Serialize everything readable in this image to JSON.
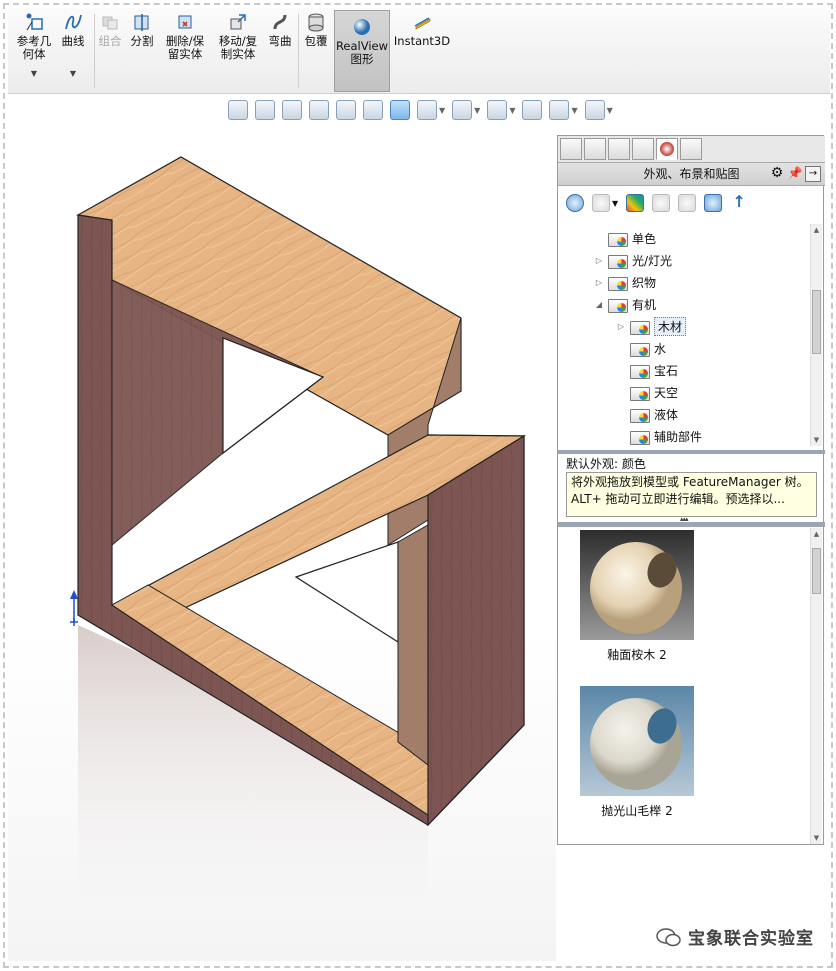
{
  "ribbon": {
    "buttons": [
      {
        "id": "ref-geometry",
        "label": "参考几\n何体",
        "has_caret": true
      },
      {
        "id": "curves",
        "label": "曲线",
        "has_caret": true
      },
      {
        "id": "combine",
        "label": "组合",
        "disabled": true
      },
      {
        "id": "split",
        "label": "分割"
      },
      {
        "id": "delete-keep-body",
        "label": "删除/保\n留实体"
      },
      {
        "id": "move-copy-body",
        "label": "移动/复\n制实体"
      },
      {
        "id": "flex",
        "label": "弯曲"
      },
      {
        "id": "wrap",
        "label": "包覆"
      },
      {
        "id": "realview",
        "label": "RealView\n图形",
        "active": true
      },
      {
        "id": "instant3d",
        "label": "Instant3D"
      }
    ]
  },
  "taskpane": {
    "title": "外观、布景和贴图",
    "tree": [
      {
        "label": "单色",
        "level": 1,
        "expand": ""
      },
      {
        "label": "光/灯光",
        "level": 1,
        "expand": "▷"
      },
      {
        "label": "织物",
        "level": 1,
        "expand": "▷"
      },
      {
        "label": "有机",
        "level": 1,
        "expand": "◢"
      },
      {
        "label": "木材",
        "level": 2,
        "expand": "▷",
        "highlighted": true
      },
      {
        "label": "水",
        "level": 2,
        "expand": ""
      },
      {
        "label": "宝石",
        "level": 2,
        "expand": ""
      },
      {
        "label": "天空",
        "level": 2,
        "expand": ""
      },
      {
        "label": "液体",
        "level": 2,
        "expand": ""
      },
      {
        "label": "辅助部件",
        "level": 2,
        "expand": ""
      }
    ],
    "default_appearance": "默认外观: 颜色",
    "tooltip": "将外观拖放到模型或 FeatureManager 树。ALT+ 拖动可立即进行编辑。预选择以...",
    "swatches": [
      {
        "label": "釉面桉木 2",
        "color": "#e9dcc4"
      },
      {
        "label": "抛光山毛榉 2",
        "color": "#e3e0d8"
      }
    ]
  },
  "watermark": "宝象联合实验室",
  "colors": {
    "wood_light": "#e7b584",
    "wood_dark": "#7d5552",
    "wood_side": "#a27e6a"
  }
}
